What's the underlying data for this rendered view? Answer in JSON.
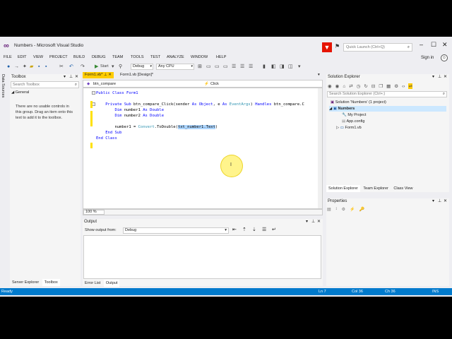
{
  "window": {
    "title": "Numbers - Microsoft Visual Studio"
  },
  "quick_launch": {
    "placeholder": "Quick Launch (Ctrl+Q)"
  },
  "menu": [
    "FILE",
    "EDIT",
    "VIEW",
    "PROJECT",
    "BUILD",
    "DEBUG",
    "TEAM",
    "TOOLS",
    "TEST",
    "ANALYZE",
    "WINDOW",
    "HELP"
  ],
  "signin": "Sign in",
  "toolbar": {
    "start_label": "Start",
    "config": "Debug",
    "platform": "Any CPU"
  },
  "leftstrip": {
    "label": "Data Sources"
  },
  "toolbox": {
    "title": "Toolbox",
    "search_placeholder": "Search Toolbox",
    "group": "General",
    "empty_message": "There are no usable controls in this group. Drag an item onto this text to add it to the toolbox.",
    "tabs": [
      "Server Explorer",
      "Toolbox"
    ]
  },
  "editor": {
    "tabs": [
      "Form1.vb*",
      "Form1.vb [Design]*"
    ],
    "nav_left": "btn_compare",
    "nav_right": "Click",
    "zoom": "100 %",
    "lines": {
      "l1": "Public Class Form1",
      "l2_a": "Private Sub",
      "l2_b": " btn_compare_Click(sender ",
      "l2_c": "As Object",
      "l2_d": ", e ",
      "l2_e": "As",
      "l2_f": " EventArgs",
      "l2_g": ") ",
      "l2_h": "Handles",
      "l2_i": " btn_compare.C",
      "l3_a": "Dim",
      "l3_b": " number1 ",
      "l3_c": "As Double",
      "l4_a": "Dim",
      "l4_b": " number2 ",
      "l4_c": "As Double",
      "l5_a": "number1 = ",
      "l5_b": "Convert",
      "l5_c": ".ToDouble(",
      "l5_d": "txt_number1.Text",
      "l5_e": ")",
      "l6": "End Sub",
      "l7": "End Class"
    }
  },
  "output": {
    "title": "Output",
    "show_from_label": "Show output from:",
    "show_from_value": "Debug",
    "tabs": [
      "Error List",
      "Output"
    ]
  },
  "solution_explorer": {
    "title": "Solution Explorer",
    "search_placeholder": "Search Solution Explorer (Ctrl+;)",
    "items": [
      "Solution 'Numbers' (1 project)",
      "Numbers",
      "My Project",
      "App.config",
      "Form1.vb"
    ],
    "tabs": [
      "Solution Explorer",
      "Team Explorer",
      "Class View"
    ]
  },
  "properties": {
    "title": "Properties"
  },
  "status": {
    "ready": "Ready",
    "line": "Ln 7",
    "col": "Col 36",
    "ch": "Ch 36",
    "mode": "INS"
  },
  "colors": {
    "accent": "#007acc",
    "active_tab": "#ffcc00",
    "notification": "#e51400"
  }
}
